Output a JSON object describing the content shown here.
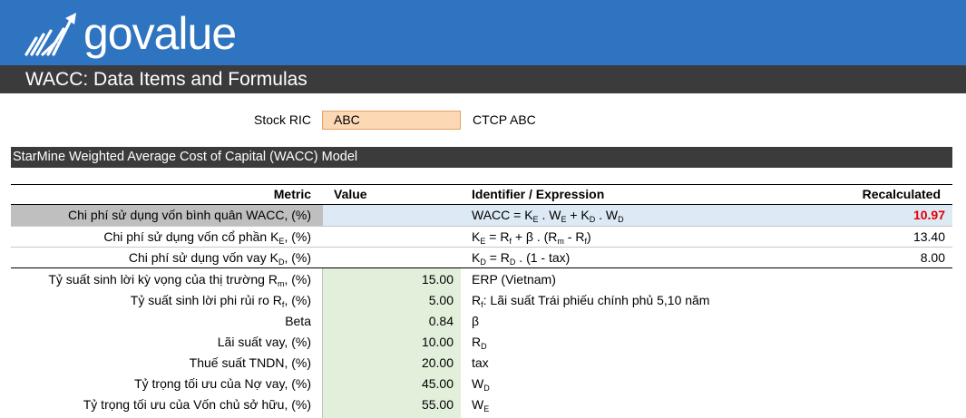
{
  "brand": {
    "logo_text": "govalue"
  },
  "page": {
    "title": "WACC: Data Items and Formulas"
  },
  "stock": {
    "label": "Stock RIC",
    "value": "ABC",
    "company": "CTCP ABC"
  },
  "section": {
    "title": "StarMine Weighted Average Cost of Capital (WACC) Model"
  },
  "table": {
    "headers": {
      "metric": "Metric",
      "value": "Value",
      "expression": "Identifier / Expression",
      "recalculated": "Recalculated"
    },
    "rows": [
      {
        "metric": "Chi phí sử dụng vốn bình quân WACC, (%)",
        "value": "",
        "recalc": "10.97"
      },
      {
        "metric_pre": "Chi phí sử dụng vốn cổ phần K",
        "metric_sub": "E",
        "metric_post": ", (%)",
        "value": "",
        "recalc": "13.40"
      },
      {
        "metric_pre": "Chi phí sử dụng vốn vay K",
        "metric_sub": "D",
        "metric_post": ", (%)",
        "value": "",
        "recalc": "8.00"
      },
      {
        "metric_pre": "Tỷ suất sinh lời kỳ vọng của thị trường R",
        "metric_sub": "m",
        "metric_post": ", (%)",
        "value": "15.00",
        "expr": "ERP (Vietnam)"
      },
      {
        "metric_pre": "Tỷ suất sinh lời phi rủi ro R",
        "metric_sub": "f",
        "metric_post": ", (%)",
        "value": "5.00",
        "expr_pre": "R",
        "expr_sub": "f",
        "expr_post": ": Lãi suất Trái phiếu chính phủ 5,10 năm"
      },
      {
        "metric": "Beta",
        "value": "0.84",
        "expr": "β"
      },
      {
        "metric": "Lãi suất vay, (%)",
        "value": "10.00",
        "expr_pre": "R",
        "expr_sub": "D",
        "expr_post": ""
      },
      {
        "metric": "Thuế suất TNDN, (%)",
        "value": "20.00",
        "expr": "tax"
      },
      {
        "metric": "Tỷ trọng tối ưu của Nợ vay, (%)",
        "value": "45.00",
        "expr_pre": "W",
        "expr_sub": "D",
        "expr_post": ""
      },
      {
        "metric": "Tỷ trọng tối ưu của Vốn chủ sở hữu, (%)",
        "value": "55.00",
        "expr_pre": "W",
        "expr_sub": "E",
        "expr_post": ""
      }
    ]
  },
  "formulas": {
    "wacc": {
      "a": "WACC = K",
      "a_sub": "E",
      "b": " . W",
      "b_sub": "E",
      "c": " +  K",
      "c_sub": "D",
      "d": " . W",
      "d_sub": "D"
    },
    "ke": {
      "a": "K",
      "a_sub": "E",
      "b": " = R",
      "b_sub": "f",
      "c": " + β . (R",
      "c_sub": "m",
      "d": " - R",
      "d_sub": "f",
      "e": ")"
    },
    "kd": {
      "a": "K",
      "a_sub": "D",
      "b": " = R",
      "b_sub": "D",
      "c": " . (1 - tax)"
    }
  },
  "colors": {
    "header_blue": "#2f74c0",
    "title_dark": "#3b3b3b",
    "input_orange": "#fdd8b5",
    "input_green": "#e2efda",
    "highlight_red": "#e00000"
  }
}
